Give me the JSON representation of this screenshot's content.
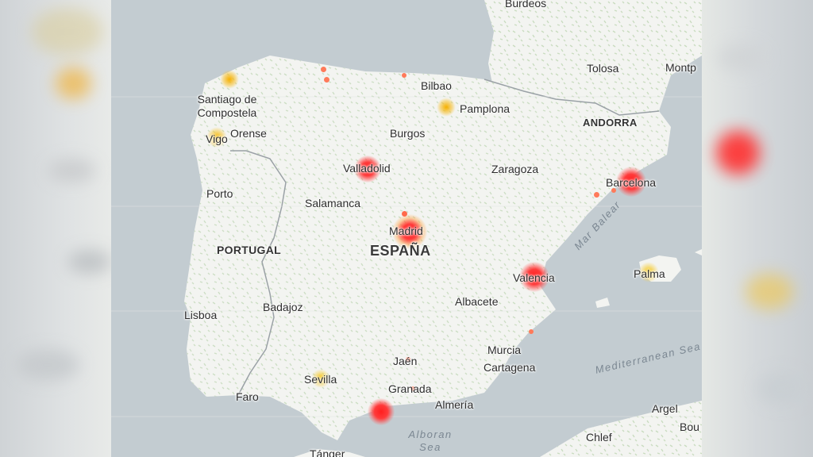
{
  "map": {
    "countries": [
      {
        "key": "portugal",
        "label": "PORTUGAL"
      },
      {
        "key": "andorra",
        "label": "ANDORRA"
      },
      {
        "key": "espana",
        "label": "ESPAÑA"
      }
    ],
    "cities": [
      {
        "key": "burdeos",
        "label": "Burdeos"
      },
      {
        "key": "tolosa",
        "label": "Tolosa"
      },
      {
        "key": "montp",
        "label": "Montp"
      },
      {
        "key": "bilbao",
        "label": "Bilbao"
      },
      {
        "key": "pamplona",
        "label": "Pamplona"
      },
      {
        "key": "santiago",
        "label": "Santiago de Compostela"
      },
      {
        "key": "orense",
        "label": "Orense"
      },
      {
        "key": "vigo",
        "label": "Vigo"
      },
      {
        "key": "burgos",
        "label": "Burgos"
      },
      {
        "key": "valladolid",
        "label": "Valladolid"
      },
      {
        "key": "zaragoza",
        "label": "Zaragoza"
      },
      {
        "key": "barcelona",
        "label": "Barcelona"
      },
      {
        "key": "porto",
        "label": "Porto"
      },
      {
        "key": "salamanca",
        "label": "Salamanca"
      },
      {
        "key": "madrid",
        "label": "Madrid"
      },
      {
        "key": "palma",
        "label": "Palma"
      },
      {
        "key": "valencia",
        "label": "Valencia"
      },
      {
        "key": "badajoz",
        "label": "Badajoz"
      },
      {
        "key": "albacete",
        "label": "Albacete"
      },
      {
        "key": "lisboa",
        "label": "Lisboa"
      },
      {
        "key": "murcia",
        "label": "Murcia"
      },
      {
        "key": "jaen",
        "label": "Jaén"
      },
      {
        "key": "cartagena",
        "label": "Cartagena"
      },
      {
        "key": "sevilla",
        "label": "Sevilla"
      },
      {
        "key": "granada",
        "label": "Granada"
      },
      {
        "key": "faro",
        "label": "Faro"
      },
      {
        "key": "almeria",
        "label": "Almería"
      },
      {
        "key": "argel",
        "label": "Argel"
      },
      {
        "key": "bou",
        "label": "Bou"
      },
      {
        "key": "chlef",
        "label": "Chlef"
      },
      {
        "key": "tanger",
        "label": "Tánger"
      }
    ],
    "seas": [
      {
        "key": "mar_balear",
        "label": "Mar Balear"
      },
      {
        "key": "mediterranean",
        "label": "Mediterranean Sea"
      },
      {
        "key": "alboran",
        "label": "Alboran Sea"
      }
    ],
    "hotspots": [
      {
        "name": "valladolid",
        "level": "high"
      },
      {
        "name": "madrid",
        "level": "high"
      },
      {
        "name": "barcelona",
        "level": "high"
      },
      {
        "name": "valencia",
        "level": "high"
      },
      {
        "name": "malaga",
        "level": "high"
      },
      {
        "name": "santiago",
        "level": "medium"
      },
      {
        "name": "pamplona",
        "level": "medium"
      },
      {
        "name": "vigo",
        "level": "medium"
      },
      {
        "name": "sevilla",
        "level": "medium"
      },
      {
        "name": "palma",
        "level": "medium"
      }
    ],
    "colors": {
      "water": "#c3ccd1",
      "land": "#f3f4f1",
      "border": "#9aa1a6",
      "high": "#ff2a2a",
      "medium": "#f6b000",
      "low": "#f7e36a"
    }
  }
}
